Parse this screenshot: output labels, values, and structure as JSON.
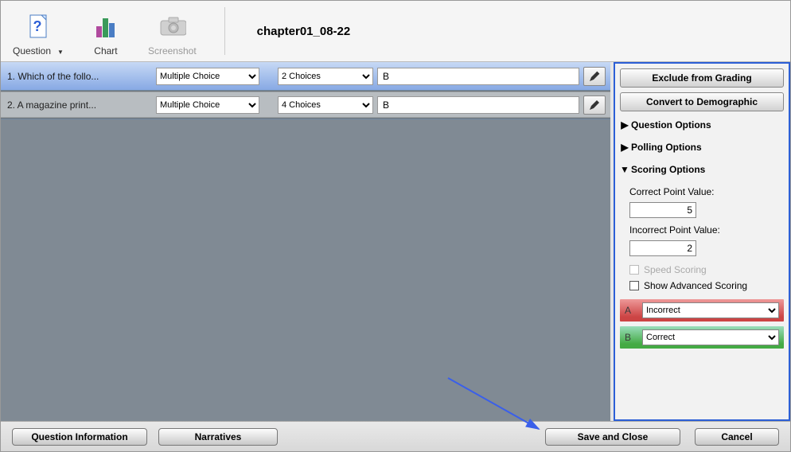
{
  "toolbar": {
    "question_label": "Question",
    "chart_label": "Chart",
    "screenshot_label": "Screenshot"
  },
  "title": "chapter01_08-22",
  "questions": [
    {
      "label": "1. Which of the follo...",
      "type": "Multiple Choice",
      "choices": "2 Choices",
      "answer": "B"
    },
    {
      "label": "2. A magazine print...",
      "type": "Multiple Choice",
      "choices": "4 Choices",
      "answer": "B"
    }
  ],
  "right": {
    "exclude_label": "Exclude from Grading",
    "convert_label": "Convert to Demographic",
    "question_options": "Question Options",
    "polling_options": "Polling Options",
    "scoring_options": "Scoring Options",
    "correct_label": "Correct Point Value:",
    "correct_value": "5",
    "incorrect_label": "Incorrect Point Value:",
    "incorrect_value": "2",
    "speed_label": "Speed Scoring",
    "advanced_label": "Show Advanced Scoring",
    "answers": [
      {
        "letter": "A",
        "status": "Incorrect"
      },
      {
        "letter": "B",
        "status": "Correct"
      }
    ]
  },
  "bottom": {
    "info_label": "Question Information",
    "narratives_label": "Narratives",
    "save_label": "Save and Close",
    "cancel_label": "Cancel"
  }
}
